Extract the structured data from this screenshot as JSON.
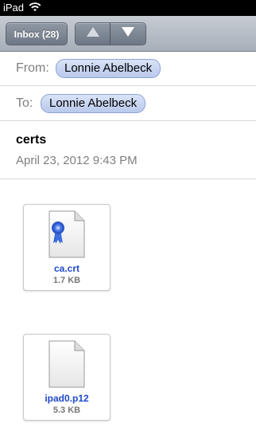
{
  "status_bar": {
    "device": "iPad",
    "wifi_icon": "wifi-icon"
  },
  "toolbar": {
    "inbox_label": "Inbox (28)",
    "prev_icon": "arrow-up-icon",
    "next_icon": "arrow-down-icon"
  },
  "header": {
    "from_label": "From:",
    "from_name": "Lonnie Abelbeck",
    "to_label": "To:",
    "to_name": "Lonnie Abelbeck",
    "subject": "certs",
    "date": "April 23, 2012 9:43 PM"
  },
  "attachments": [
    {
      "name": "ca.crt",
      "size": "1.7 KB",
      "icon": "certificate-file-icon"
    },
    {
      "name": "ipad0.p12",
      "size": "5.3 KB",
      "icon": "generic-file-icon"
    }
  ],
  "colors": {
    "chip_bg": "#c9d6f3",
    "link_blue": "#1f49c9",
    "toolbar_bg": "#b4bbc5"
  }
}
